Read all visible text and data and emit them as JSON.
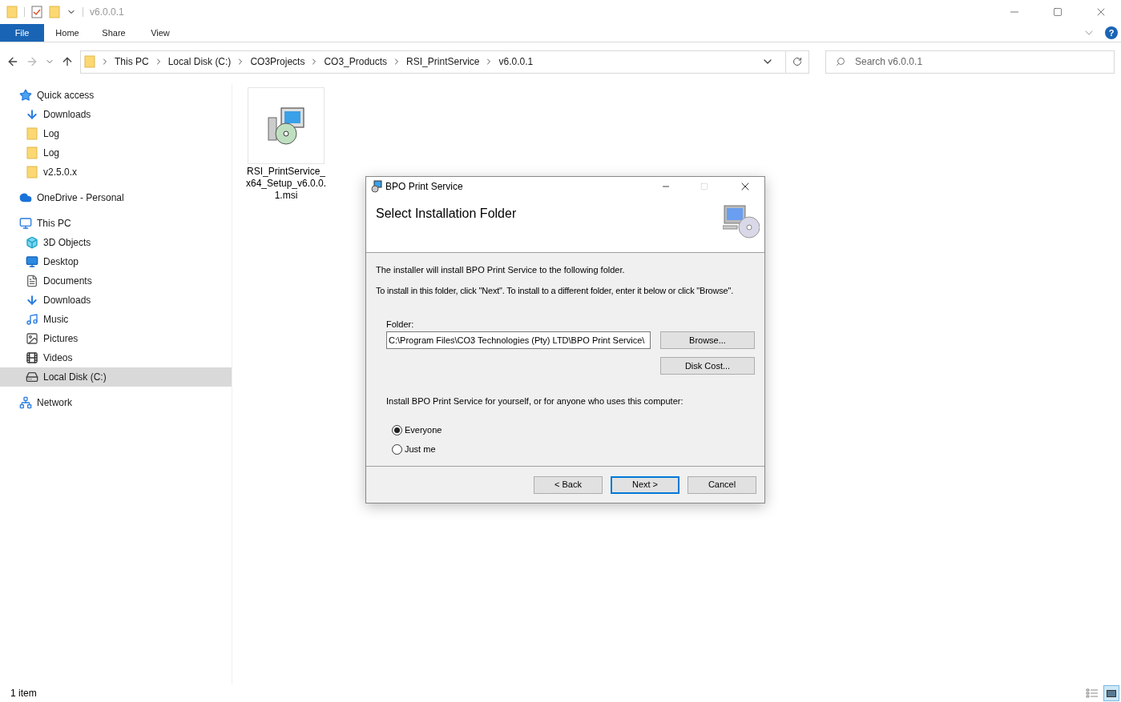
{
  "window": {
    "title": "v6.0.0.1"
  },
  "ribbon_tabs": [
    {
      "label": "File",
      "selected": true
    },
    {
      "label": "Home",
      "selected": false
    },
    {
      "label": "Share",
      "selected": false
    },
    {
      "label": "View",
      "selected": false
    }
  ],
  "breadcrumb": [
    "This PC",
    "Local Disk (C:)",
    "CO3Projects",
    "CO3_Products",
    "RSI_PrintService",
    "v6.0.0.1"
  ],
  "search": {
    "placeholder": "Search v6.0.0.1"
  },
  "help": {
    "glyph": "?"
  },
  "sidebar": {
    "items": [
      {
        "label": "Quick access",
        "kind": "star",
        "selected": false,
        "children": [
          {
            "label": "Downloads",
            "kind": "download",
            "selected": false
          },
          {
            "label": "Log",
            "kind": "folder",
            "selected": false
          },
          {
            "label": "Log",
            "kind": "folder",
            "selected": false
          },
          {
            "label": "v2.5.0.x",
            "kind": "folder",
            "selected": false
          }
        ]
      },
      {
        "label": "OneDrive - Personal",
        "kind": "cloud",
        "selected": false
      },
      {
        "label": "This PC",
        "kind": "pc",
        "selected": false,
        "children": [
          {
            "label": "3D Objects",
            "kind": "cube",
            "selected": false
          },
          {
            "label": "Desktop",
            "kind": "desktop",
            "selected": false
          },
          {
            "label": "Documents",
            "kind": "document",
            "selected": false
          },
          {
            "label": "Downloads",
            "kind": "download",
            "selected": false
          },
          {
            "label": "Music",
            "kind": "music",
            "selected": false
          },
          {
            "label": "Pictures",
            "kind": "picture",
            "selected": false
          },
          {
            "label": "Videos",
            "kind": "video",
            "selected": false
          },
          {
            "label": "Local Disk (C:)",
            "kind": "drive",
            "selected": true
          }
        ]
      },
      {
        "label": "Network",
        "kind": "network",
        "selected": false
      }
    ]
  },
  "files": [
    {
      "name": "RSI_PrintService_\nx64_Setup_v6.0.0.\n1.msi"
    }
  ],
  "status_bar": {
    "count": "1 item"
  },
  "dialog": {
    "title": "BPO Print Service",
    "heading": "Select Installation Folder",
    "intro": "The installer will install BPO Print Service to the following folder.",
    "instructions": "To install in this folder, click \"Next\". To install to a different folder, enter it below or click \"Browse\".",
    "folder_label": "Folder:",
    "folder_value": "C:\\Program Files\\CO3 Technologies (Pty) LTD\\BPO Print Service\\",
    "side_buttons": [
      "Browse...",
      "Disk Cost..."
    ],
    "scope_question": "Install BPO Print Service for yourself, or for anyone who uses this computer:",
    "options": [
      {
        "label": "Everyone",
        "selected": true
      },
      {
        "label": "Just me",
        "selected": false
      }
    ],
    "buttons": [
      {
        "label": "< Back",
        "default": false
      },
      {
        "label": "Next >",
        "default": true
      },
      {
        "label": "Cancel",
        "default": false
      }
    ]
  }
}
